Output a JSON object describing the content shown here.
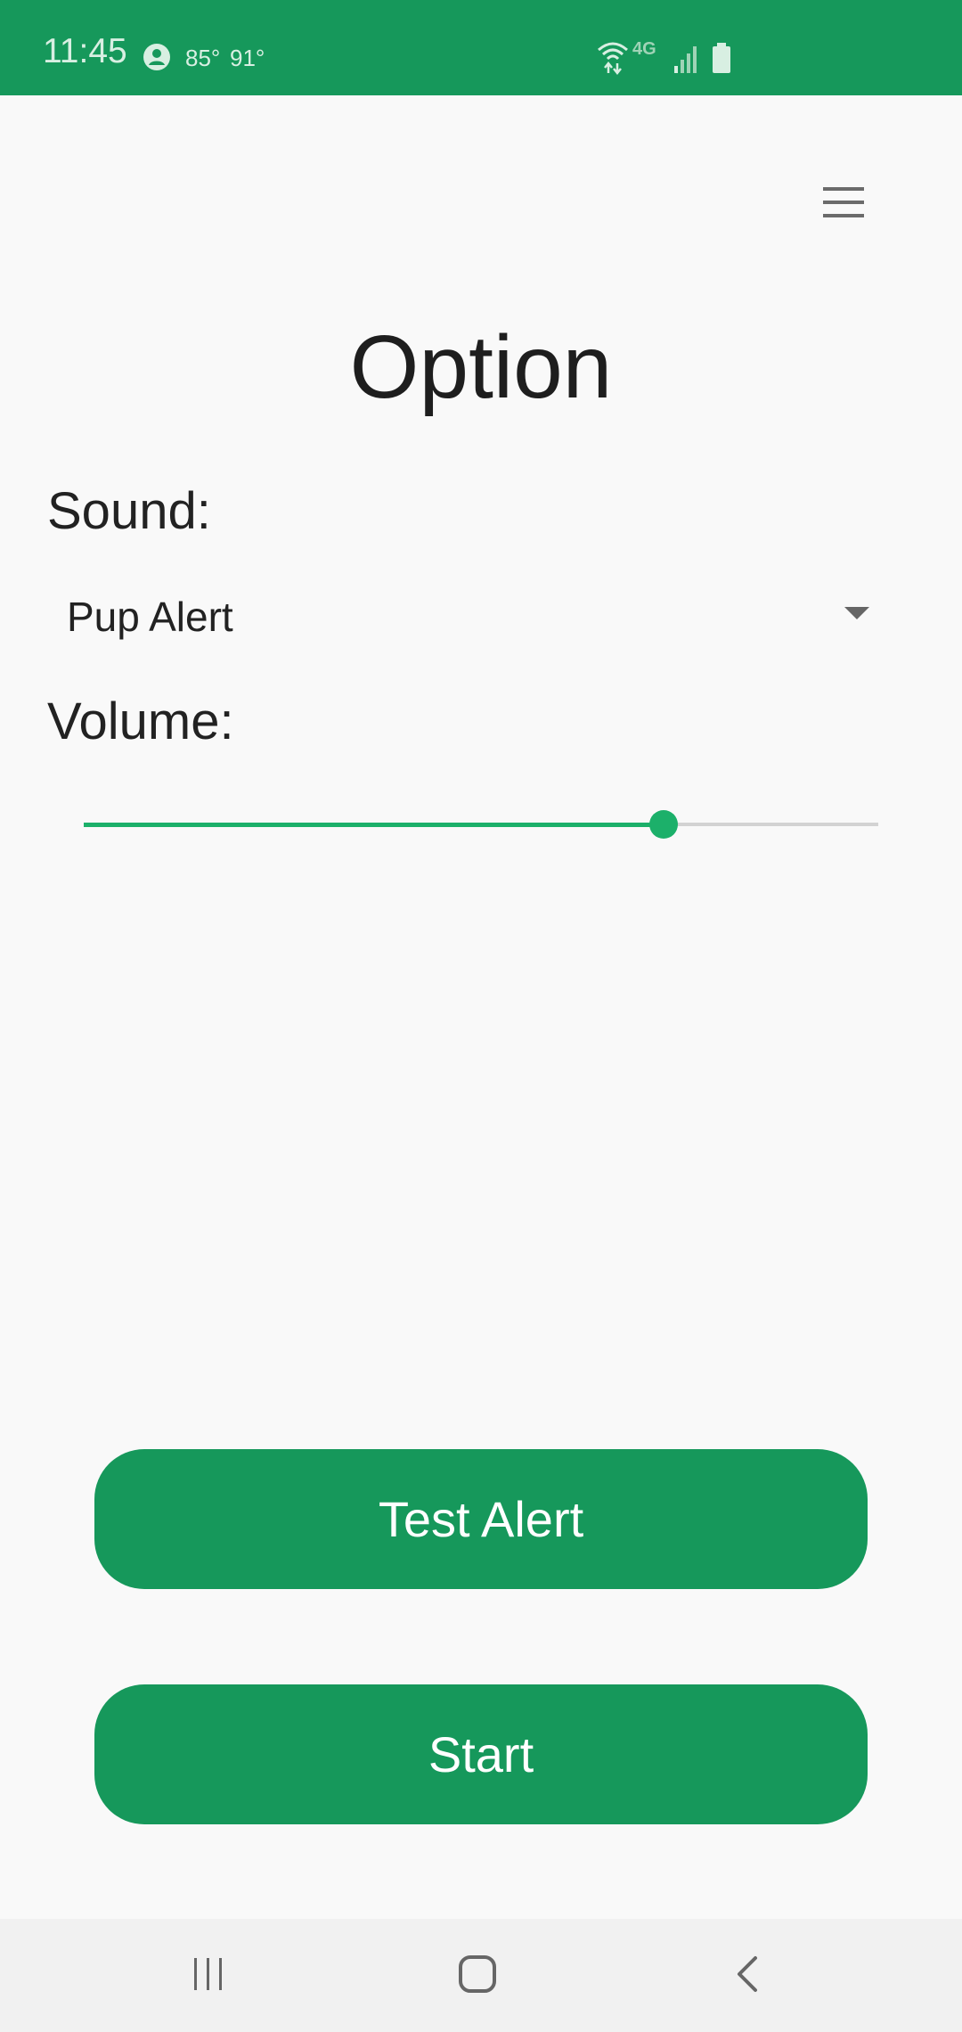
{
  "status_bar": {
    "time": "11:45",
    "temp_current": "85°",
    "temp_high": "91°",
    "network": "4G",
    "icons": [
      "person-icon",
      "wifi-icon",
      "signal-icon",
      "battery-icon"
    ]
  },
  "header": {
    "menu_icon": "hamburger-menu-icon"
  },
  "page": {
    "title": "Option"
  },
  "sound": {
    "label": "Sound:",
    "selected": "Pup Alert"
  },
  "volume": {
    "label": "Volume:",
    "level_percent": 73
  },
  "buttons": {
    "test_alert": "Test Alert",
    "start": "Start"
  },
  "nav_bar": {
    "icons": [
      "recents-icon",
      "home-icon",
      "back-icon"
    ]
  },
  "colors": {
    "accent": "#16985b",
    "slider": "#1cb06a"
  }
}
